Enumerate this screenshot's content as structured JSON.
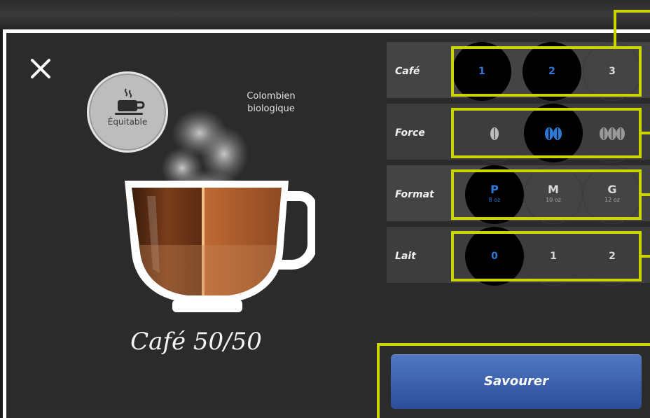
{
  "badge": {
    "label": "Équitable",
    "icon": "coffee-cup-icon"
  },
  "origin": {
    "line1": "Colombien",
    "line2": "biologique"
  },
  "drink": {
    "name": "Café 50/50"
  },
  "options": {
    "cafe": {
      "label": "Café",
      "choices": [
        "1",
        "2",
        "3"
      ],
      "selected": [
        "1",
        "2"
      ]
    },
    "force": {
      "label": "Force",
      "choices": [
        "1 bean",
        "2 beans",
        "3 beans"
      ],
      "selected": "2 beans"
    },
    "format": {
      "label": "Format",
      "choices": [
        {
          "letter": "P",
          "size": "8 oz"
        },
        {
          "letter": "M",
          "size": "10 oz"
        },
        {
          "letter": "G",
          "size": "12 oz"
        }
      ],
      "selected": "P"
    },
    "lait": {
      "label": "Lait",
      "choices": [
        "0",
        "1",
        "2"
      ],
      "selected": "0"
    }
  },
  "cta": {
    "label": "Savourer"
  },
  "colors": {
    "accent": "#c9d400",
    "selected_text": "#2f78d8",
    "button": "#3a5fae"
  }
}
